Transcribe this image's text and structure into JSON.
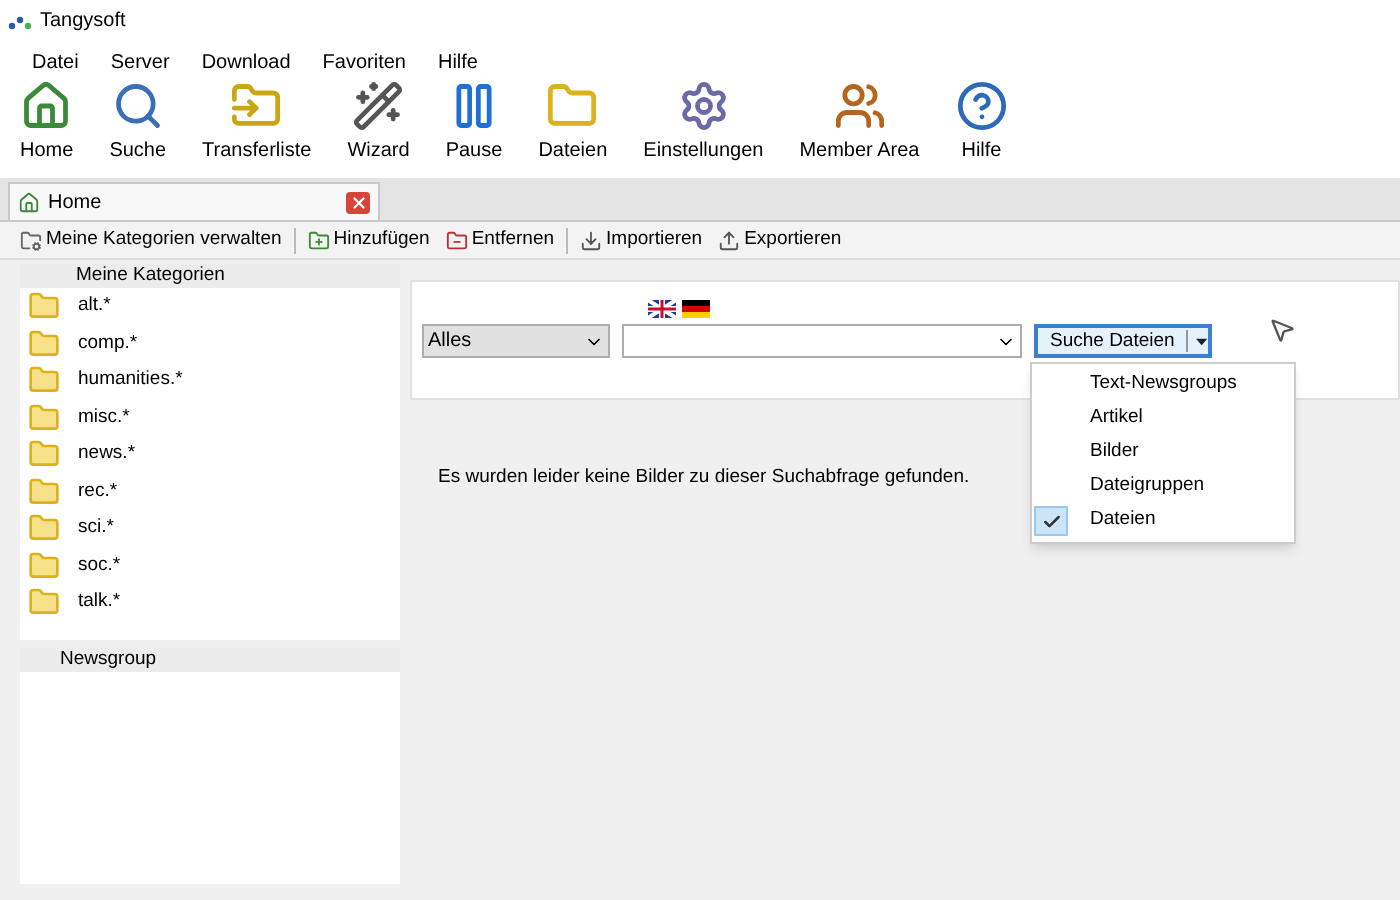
{
  "window": {
    "title": "Tangysoft"
  },
  "menu": [
    "Datei",
    "Server",
    "Download",
    "Favoriten",
    "Hilfe"
  ],
  "toolbar": [
    {
      "label": "Home",
      "kind": "home"
    },
    {
      "label": "Suche",
      "kind": "search"
    },
    {
      "label": "Transferliste",
      "kind": "transfer"
    },
    {
      "label": "Wizard",
      "kind": "wizard"
    },
    {
      "label": "Pause",
      "kind": "pause"
    },
    {
      "label": "Dateien",
      "kind": "folder"
    },
    {
      "label": "Einstellungen",
      "kind": "settings"
    },
    {
      "label": "Member Area",
      "kind": "users"
    },
    {
      "label": "Hilfe",
      "kind": "help"
    }
  ],
  "tab": {
    "label": "Home"
  },
  "actions": [
    {
      "label": "Meine Kategorien verwalten",
      "kind": "manage"
    },
    {
      "label": "Hinzufügen",
      "kind": "add"
    },
    {
      "label": "Entfernen",
      "kind": "remove"
    },
    {
      "label": "Importieren",
      "kind": "import"
    },
    {
      "label": "Exportieren",
      "kind": "export"
    }
  ],
  "categories": {
    "title": "Meine Kategorien",
    "items": [
      "alt.*",
      "comp.*",
      "humanities.*",
      "misc.*",
      "news.*",
      "rec.*",
      "sci.*",
      "soc.*",
      "talk.*"
    ]
  },
  "newsgroup": {
    "title": "Newsgroup"
  },
  "search": {
    "scope": "Alles",
    "button": "Suche Dateien"
  },
  "message": "Es wurden leider keine Bilder zu dieser Suchabfrage gefunden.",
  "dropdown": [
    {
      "label": "Text-Newsgroups",
      "selected": false
    },
    {
      "label": "Artikel",
      "selected": false
    },
    {
      "label": "Bilder",
      "selected": false
    },
    {
      "label": "Dateigruppen",
      "selected": false
    },
    {
      "label": "Dateien",
      "selected": true
    }
  ]
}
